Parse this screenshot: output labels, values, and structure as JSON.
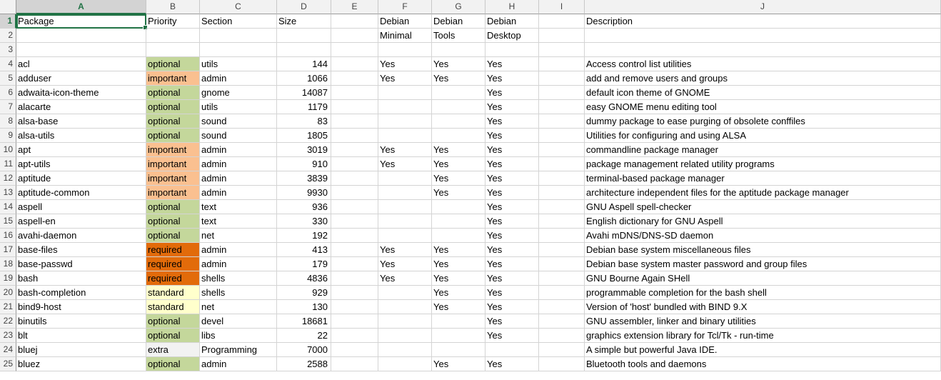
{
  "columns": [
    "A",
    "B",
    "C",
    "D",
    "E",
    "F",
    "G",
    "H",
    "I",
    "J"
  ],
  "header_row1": {
    "A": "Package",
    "B": "Priority",
    "C": "Section",
    "D": "Size",
    "E": "",
    "F": "Debian",
    "G": "Debian",
    "H": "Debian",
    "I": "",
    "J": "Description"
  },
  "header_row2": {
    "A": "",
    "B": "",
    "C": "",
    "D": "",
    "E": "",
    "F": "Minimal",
    "G": "Tools",
    "H": "Desktop",
    "I": "",
    "J": ""
  },
  "priority_colors": {
    "optional": "#c4d79b",
    "important": "#fac090",
    "required": "#e26b0a",
    "standard": "#ffffcc",
    "extra": "#f2f2f2"
  },
  "rows": [
    {
      "num": "4",
      "package": "acl",
      "priority": "optional",
      "section": "utils",
      "size": "144",
      "minimal": "Yes",
      "tools": "Yes",
      "desktop": "Yes",
      "description": "Access control list utilities"
    },
    {
      "num": "5",
      "package": "adduser",
      "priority": "important",
      "section": "admin",
      "size": "1066",
      "minimal": "Yes",
      "tools": "Yes",
      "desktop": "Yes",
      "description": "add and remove users and groups"
    },
    {
      "num": "6",
      "package": "adwaita-icon-theme",
      "priority": "optional",
      "section": "gnome",
      "size": "14087",
      "minimal": "",
      "tools": "",
      "desktop": "Yes",
      "description": "default icon theme of GNOME"
    },
    {
      "num": "7",
      "package": "alacarte",
      "priority": "optional",
      "section": "utils",
      "size": "1179",
      "minimal": "",
      "tools": "",
      "desktop": "Yes",
      "description": "easy GNOME menu editing tool"
    },
    {
      "num": "8",
      "package": "alsa-base",
      "priority": "optional",
      "section": "sound",
      "size": "83",
      "minimal": "",
      "tools": "",
      "desktop": "Yes",
      "description": "dummy package to ease purging of obsolete conffiles"
    },
    {
      "num": "9",
      "package": "alsa-utils",
      "priority": "optional",
      "section": "sound",
      "size": "1805",
      "minimal": "",
      "tools": "",
      "desktop": "Yes",
      "description": "Utilities for configuring and using ALSA"
    },
    {
      "num": "10",
      "package": "apt",
      "priority": "important",
      "section": "admin",
      "size": "3019",
      "minimal": "Yes",
      "tools": "Yes",
      "desktop": "Yes",
      "description": "commandline package manager"
    },
    {
      "num": "11",
      "package": "apt-utils",
      "priority": "important",
      "section": "admin",
      "size": "910",
      "minimal": "Yes",
      "tools": "Yes",
      "desktop": "Yes",
      "description": "package management related utility programs"
    },
    {
      "num": "12",
      "package": "aptitude",
      "priority": "important",
      "section": "admin",
      "size": "3839",
      "minimal": "",
      "tools": "Yes",
      "desktop": "Yes",
      "description": "terminal-based package manager"
    },
    {
      "num": "13",
      "package": "aptitude-common",
      "priority": "important",
      "section": "admin",
      "size": "9930",
      "minimal": "",
      "tools": "Yes",
      "desktop": "Yes",
      "description": "architecture independent files for the aptitude package manager"
    },
    {
      "num": "14",
      "package": "aspell",
      "priority": "optional",
      "section": "text",
      "size": "936",
      "minimal": "",
      "tools": "",
      "desktop": "Yes",
      "description": "GNU Aspell spell-checker"
    },
    {
      "num": "15",
      "package": "aspell-en",
      "priority": "optional",
      "section": "text",
      "size": "330",
      "minimal": "",
      "tools": "",
      "desktop": "Yes",
      "description": "English dictionary for GNU Aspell"
    },
    {
      "num": "16",
      "package": "avahi-daemon",
      "priority": "optional",
      "section": "net",
      "size": "192",
      "minimal": "",
      "tools": "",
      "desktop": "Yes",
      "description": "Avahi mDNS/DNS-SD daemon"
    },
    {
      "num": "17",
      "package": "base-files",
      "priority": "required",
      "section": "admin",
      "size": "413",
      "minimal": "Yes",
      "tools": "Yes",
      "desktop": "Yes",
      "description": "Debian base system miscellaneous files"
    },
    {
      "num": "18",
      "package": "base-passwd",
      "priority": "required",
      "section": "admin",
      "size": "179",
      "minimal": "Yes",
      "tools": "Yes",
      "desktop": "Yes",
      "description": "Debian base system master password and group files"
    },
    {
      "num": "19",
      "package": "bash",
      "priority": "required",
      "section": "shells",
      "size": "4836",
      "minimal": "Yes",
      "tools": "Yes",
      "desktop": "Yes",
      "description": "GNU Bourne Again SHell"
    },
    {
      "num": "20",
      "package": "bash-completion",
      "priority": "standard",
      "section": "shells",
      "size": "929",
      "minimal": "",
      "tools": "Yes",
      "desktop": "Yes",
      "description": "programmable completion for the bash shell"
    },
    {
      "num": "21",
      "package": "bind9-host",
      "priority": "standard",
      "section": "net",
      "size": "130",
      "minimal": "",
      "tools": "Yes",
      "desktop": "Yes",
      "description": "Version of 'host' bundled with BIND 9.X"
    },
    {
      "num": "22",
      "package": "binutils",
      "priority": "optional",
      "section": "devel",
      "size": "18681",
      "minimal": "",
      "tools": "",
      "desktop": "Yes",
      "description": "GNU assembler, linker and binary utilities"
    },
    {
      "num": "23",
      "package": "blt",
      "priority": "optional",
      "section": "libs",
      "size": "22",
      "minimal": "",
      "tools": "",
      "desktop": "Yes",
      "description": "graphics extension library for Tcl/Tk - run-time"
    },
    {
      "num": "24",
      "package": "bluej",
      "priority": "extra",
      "section": "Programming",
      "size": "7000",
      "minimal": "",
      "tools": "",
      "desktop": "",
      "description": "A simple but powerful Java IDE."
    },
    {
      "num": "25",
      "package": "bluez",
      "priority": "optional",
      "section": "admin",
      "size": "2588",
      "minimal": "",
      "tools": "Yes",
      "desktop": "Yes",
      "description": "Bluetooth tools and daemons"
    }
  ]
}
